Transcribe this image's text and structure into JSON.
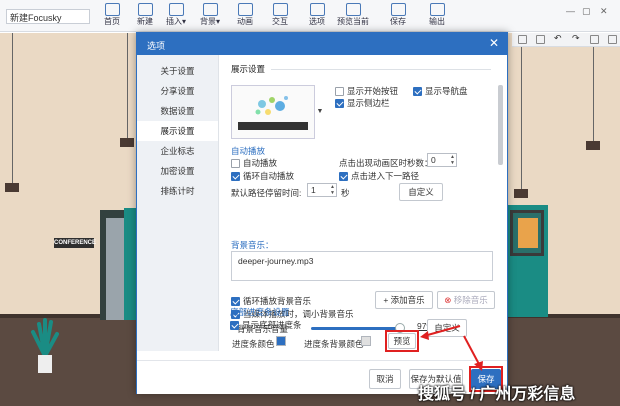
{
  "app": {
    "document_name": "新建Focusky",
    "toolbar": [
      {
        "label": "首页",
        "icon": "home-icon"
      },
      {
        "label": "新建",
        "icon": "new-file-icon"
      },
      {
        "label": "插入▾",
        "icon": "insert-icon"
      },
      {
        "label": "背景▾",
        "icon": "background-icon"
      },
      {
        "label": "动画",
        "icon": "animation-icon"
      },
      {
        "label": "交互",
        "icon": "interaction-icon"
      },
      {
        "label": "选项",
        "icon": "options-icon"
      },
      {
        "label": "预览当前",
        "icon": "preview-icon"
      },
      {
        "label": "保存",
        "icon": "save-icon"
      },
      {
        "label": "输出",
        "icon": "export-icon"
      }
    ],
    "door_sign": "CONFERENCE"
  },
  "dialog": {
    "title": "选项",
    "nav": [
      "关于设置",
      "分享设置",
      "数据设置",
      "展示设置",
      "企业标志",
      "加密设置",
      "排练计时"
    ],
    "active_nav": "展示设置",
    "display_section": "展示设置",
    "show_start_button": "显示开始按钮",
    "show_nav_bar": "显示导航盘",
    "show_sidebar": "显示侧边栏",
    "autoplay_section": "自动播放",
    "autoplay": "自动播放",
    "loop_autoplay": "循环自动播放",
    "countdown_label": "点击出现动画区时秒数：",
    "countdown_value": "0",
    "click_next": "点击进入下一路径",
    "default_dwell_label": "默认路径停留时间:",
    "default_dwell_value": "1",
    "seconds_unit": "秒",
    "custom_button": "自定义",
    "music_section": "背景音乐：",
    "music_file": "deeper-journey.mp3",
    "loop_music": "循环播放背景音乐",
    "lower_music": "当媒体播放时，调小背景音乐",
    "add_music": "+ 添加音乐",
    "remove_music": "移除音乐",
    "volume_label": "背景音乐音量",
    "volume_value": "97%",
    "volume_fraction": 0.97,
    "progress_section": "底部进度条设置",
    "show_progress": "显示底部进度条",
    "progress_color_label": "进度条颜色",
    "progress_bg_label": "进度条背景颜色",
    "preview_button": "预览",
    "progress_color": "#2d6fc0",
    "progress_bg_color": "#e0e0e0"
  },
  "footer": {
    "cancel": "取消",
    "save_default": "保存为默认值",
    "save": "保存"
  },
  "watermark": "搜狐号 / 广州万彩信息"
}
